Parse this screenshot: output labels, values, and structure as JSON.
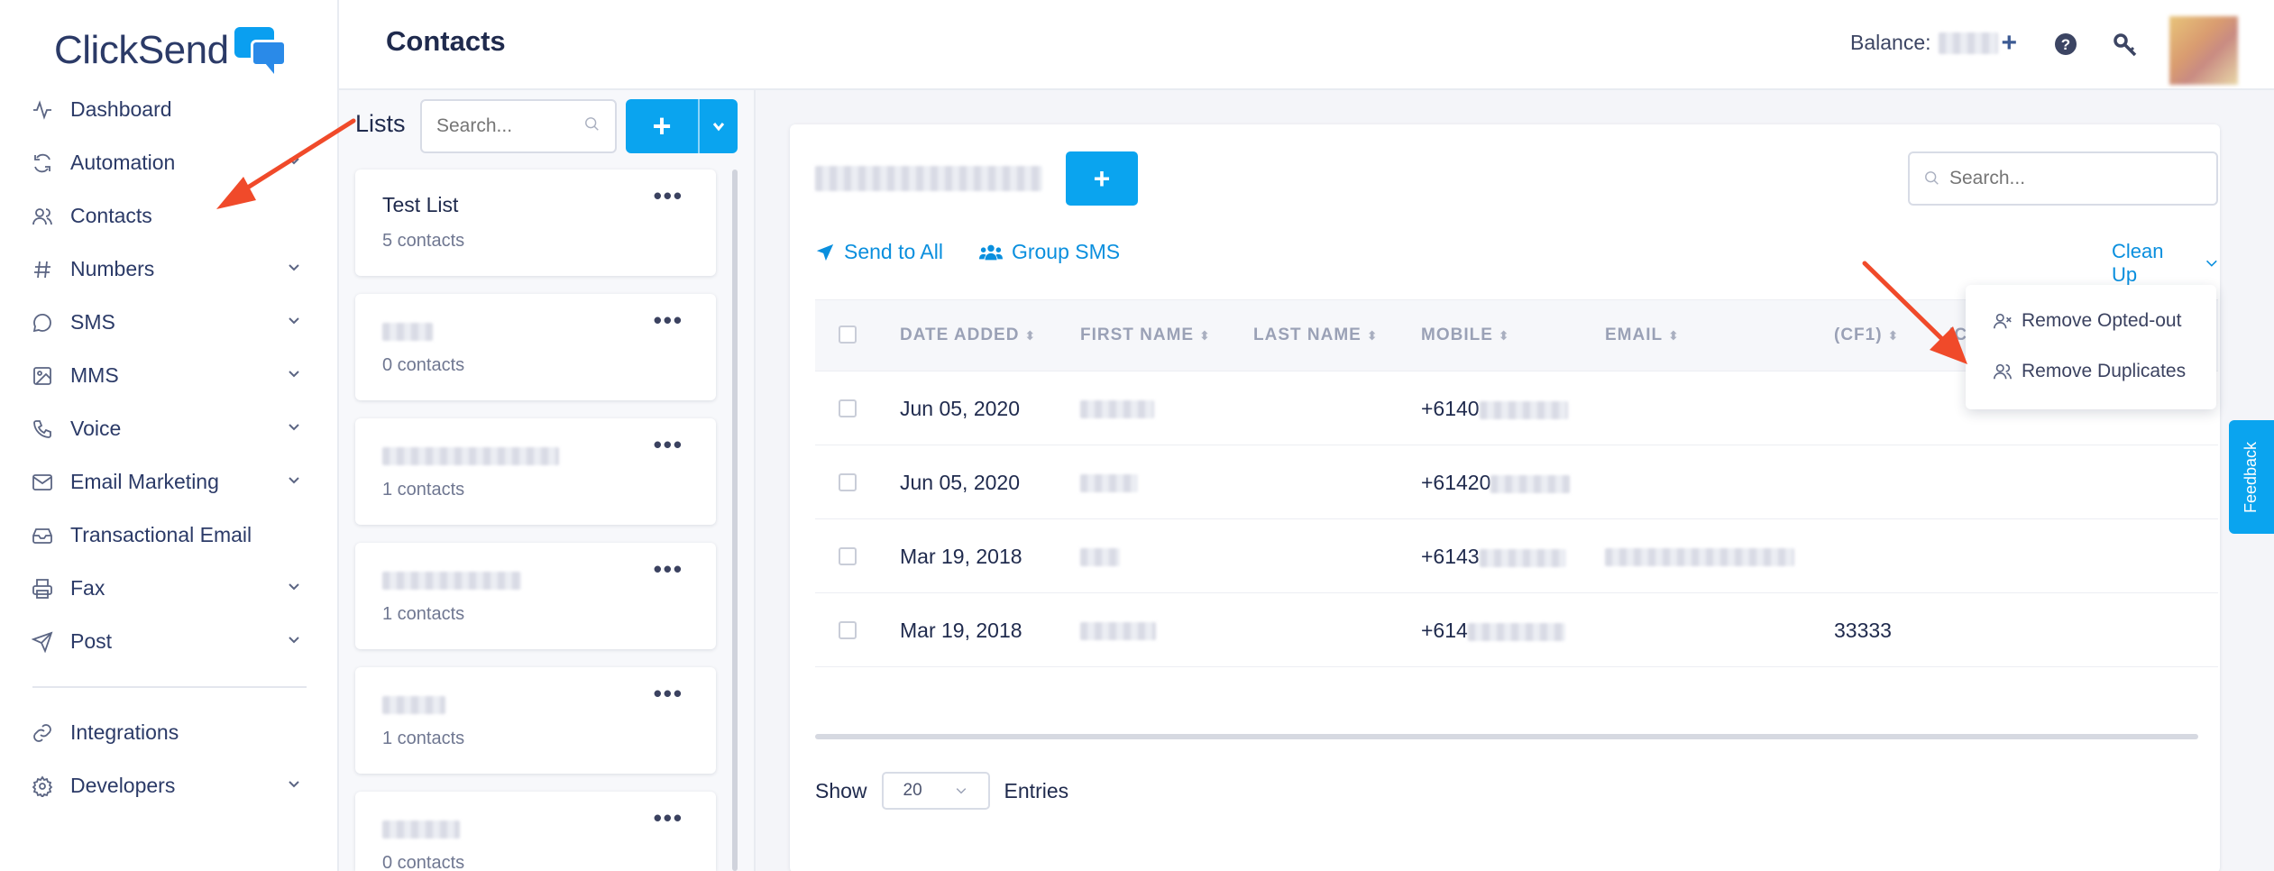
{
  "app": {
    "logo": "ClickSend"
  },
  "header": {
    "title": "Contacts",
    "balance_label": "Balance:",
    "balance_add": "+"
  },
  "sidebar": {
    "items": [
      {
        "label": "Dashboard",
        "icon": "activity-icon",
        "chevron": false
      },
      {
        "label": "Automation",
        "icon": "refresh-icon",
        "chevron": true
      },
      {
        "label": "Contacts",
        "icon": "users-icon",
        "chevron": false
      },
      {
        "label": "Numbers",
        "icon": "hash-icon",
        "chevron": true
      },
      {
        "label": "SMS",
        "icon": "message-circle-icon",
        "chevron": true
      },
      {
        "label": "MMS",
        "icon": "image-icon",
        "chevron": true
      },
      {
        "label": "Voice",
        "icon": "phone-icon",
        "chevron": true
      },
      {
        "label": "Email Marketing",
        "icon": "mail-icon",
        "chevron": true
      },
      {
        "label": "Transactional Email",
        "icon": "inbox-icon",
        "chevron": false
      },
      {
        "label": "Fax",
        "icon": "printer-icon",
        "chevron": true
      },
      {
        "label": "Post",
        "icon": "send-icon",
        "chevron": true
      }
    ],
    "bottom_items": [
      {
        "label": "Integrations",
        "icon": "link-icon",
        "chevron": false
      },
      {
        "label": "Developers",
        "icon": "settings-icon",
        "chevron": true
      }
    ]
  },
  "lists": {
    "label": "Lists",
    "search_placeholder": "Search...",
    "add_label": "+",
    "cards": [
      {
        "name": "Test List",
        "count": "5 contacts"
      },
      {
        "name": "",
        "count": "0 contacts"
      },
      {
        "name": "",
        "count": "1 contacts"
      },
      {
        "name": "",
        "count": "1 contacts"
      },
      {
        "name": "",
        "count": "1 contacts"
      },
      {
        "name": "",
        "count": "0 contacts"
      }
    ],
    "more_label": "•••"
  },
  "panel": {
    "add_label": "+",
    "search_placeholder": "Search...",
    "send_to_all": "Send to All",
    "group_sms": "Group SMS",
    "clean_up": "Clean Up",
    "columns": [
      "DATE ADDED",
      "FIRST NAME",
      "LAST NAME",
      "MOBILE",
      "EMAIL",
      "(CF1)",
      "(C"
    ],
    "rows": [
      {
        "date": "Jun 05, 2020",
        "mobile": "+6140",
        "cf1": ""
      },
      {
        "date": "Jun 05, 2020",
        "mobile": "+61420",
        "cf1": ""
      },
      {
        "date": "Mar 19, 2018",
        "mobile": "+6143",
        "cf1": ""
      },
      {
        "date": "Mar 19, 2018",
        "mobile": "+614",
        "cf1": "33333"
      }
    ],
    "show_label": "Show",
    "entries_value": "20",
    "entries_label": "Entries"
  },
  "menu": {
    "items": [
      "Remove Opted-out",
      "Remove Duplicates"
    ]
  },
  "feedback": "Feedback",
  "colors": {
    "accent": "#0aa4ef",
    "link": "#0a8fde",
    "annotation": "#f04a2a"
  }
}
